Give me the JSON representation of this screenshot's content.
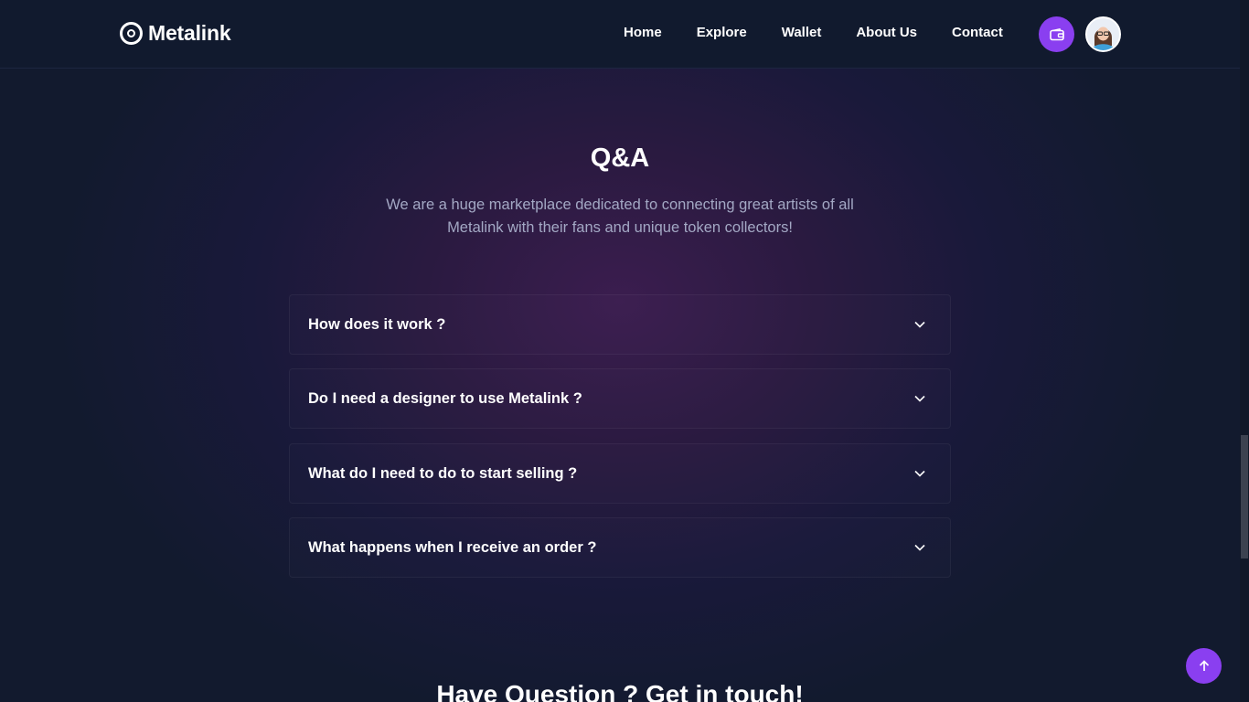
{
  "brand": {
    "name": "Metalink"
  },
  "scroll_progress": {
    "percent": 80
  },
  "nav": {
    "items": [
      {
        "label": "Home"
      },
      {
        "label": "Explore"
      },
      {
        "label": "Wallet"
      },
      {
        "label": "About Us"
      },
      {
        "label": "Contact"
      }
    ],
    "wallet_icon": "wallet-icon",
    "avatar": "user-avatar"
  },
  "qa": {
    "title": "Q&A",
    "subtitle_line1": "We are a huge marketplace dedicated to connecting great artists of all",
    "subtitle_line2": "Metalink with their fans and unique token collectors!",
    "items": [
      {
        "question": "How does it work ?"
      },
      {
        "question": "Do I need a designer to use Metalink ?"
      },
      {
        "question": "What do I need to do to start selling ?"
      },
      {
        "question": "What happens when I receive an order ?"
      }
    ]
  },
  "contact": {
    "title": "Have Question ? Get in touch!"
  },
  "colors": {
    "accent": "#8a3ff0",
    "background": "#111a2e",
    "muted_text": "#a3a8c4"
  }
}
